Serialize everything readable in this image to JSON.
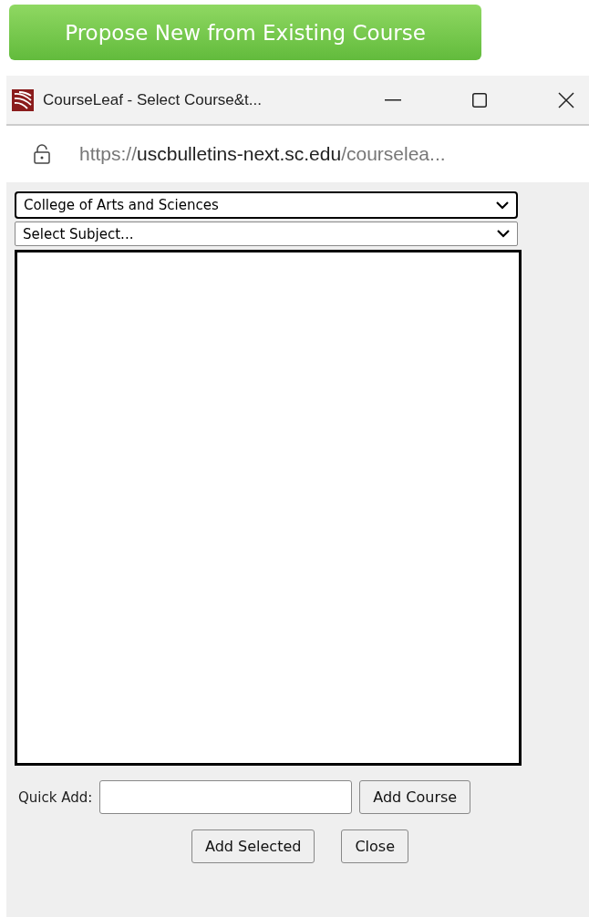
{
  "action_button": {
    "label": "Propose New from Existing Course"
  },
  "window": {
    "title": "CourseLeaf - Select Course&t..."
  },
  "address_bar": {
    "scheme": "https://",
    "host": "uscbulletins-next.sc.edu",
    "path": "/courselea..."
  },
  "college_select": {
    "value": "College of Arts and Sciences",
    "focused": true
  },
  "subject_select": {
    "value": "Select Subject...",
    "focused": false
  },
  "quick_add": {
    "label": "Quick Add:",
    "button": "Add Course"
  },
  "buttons": [
    {
      "label": "Add Selected"
    },
    {
      "label": "Close"
    }
  ]
}
